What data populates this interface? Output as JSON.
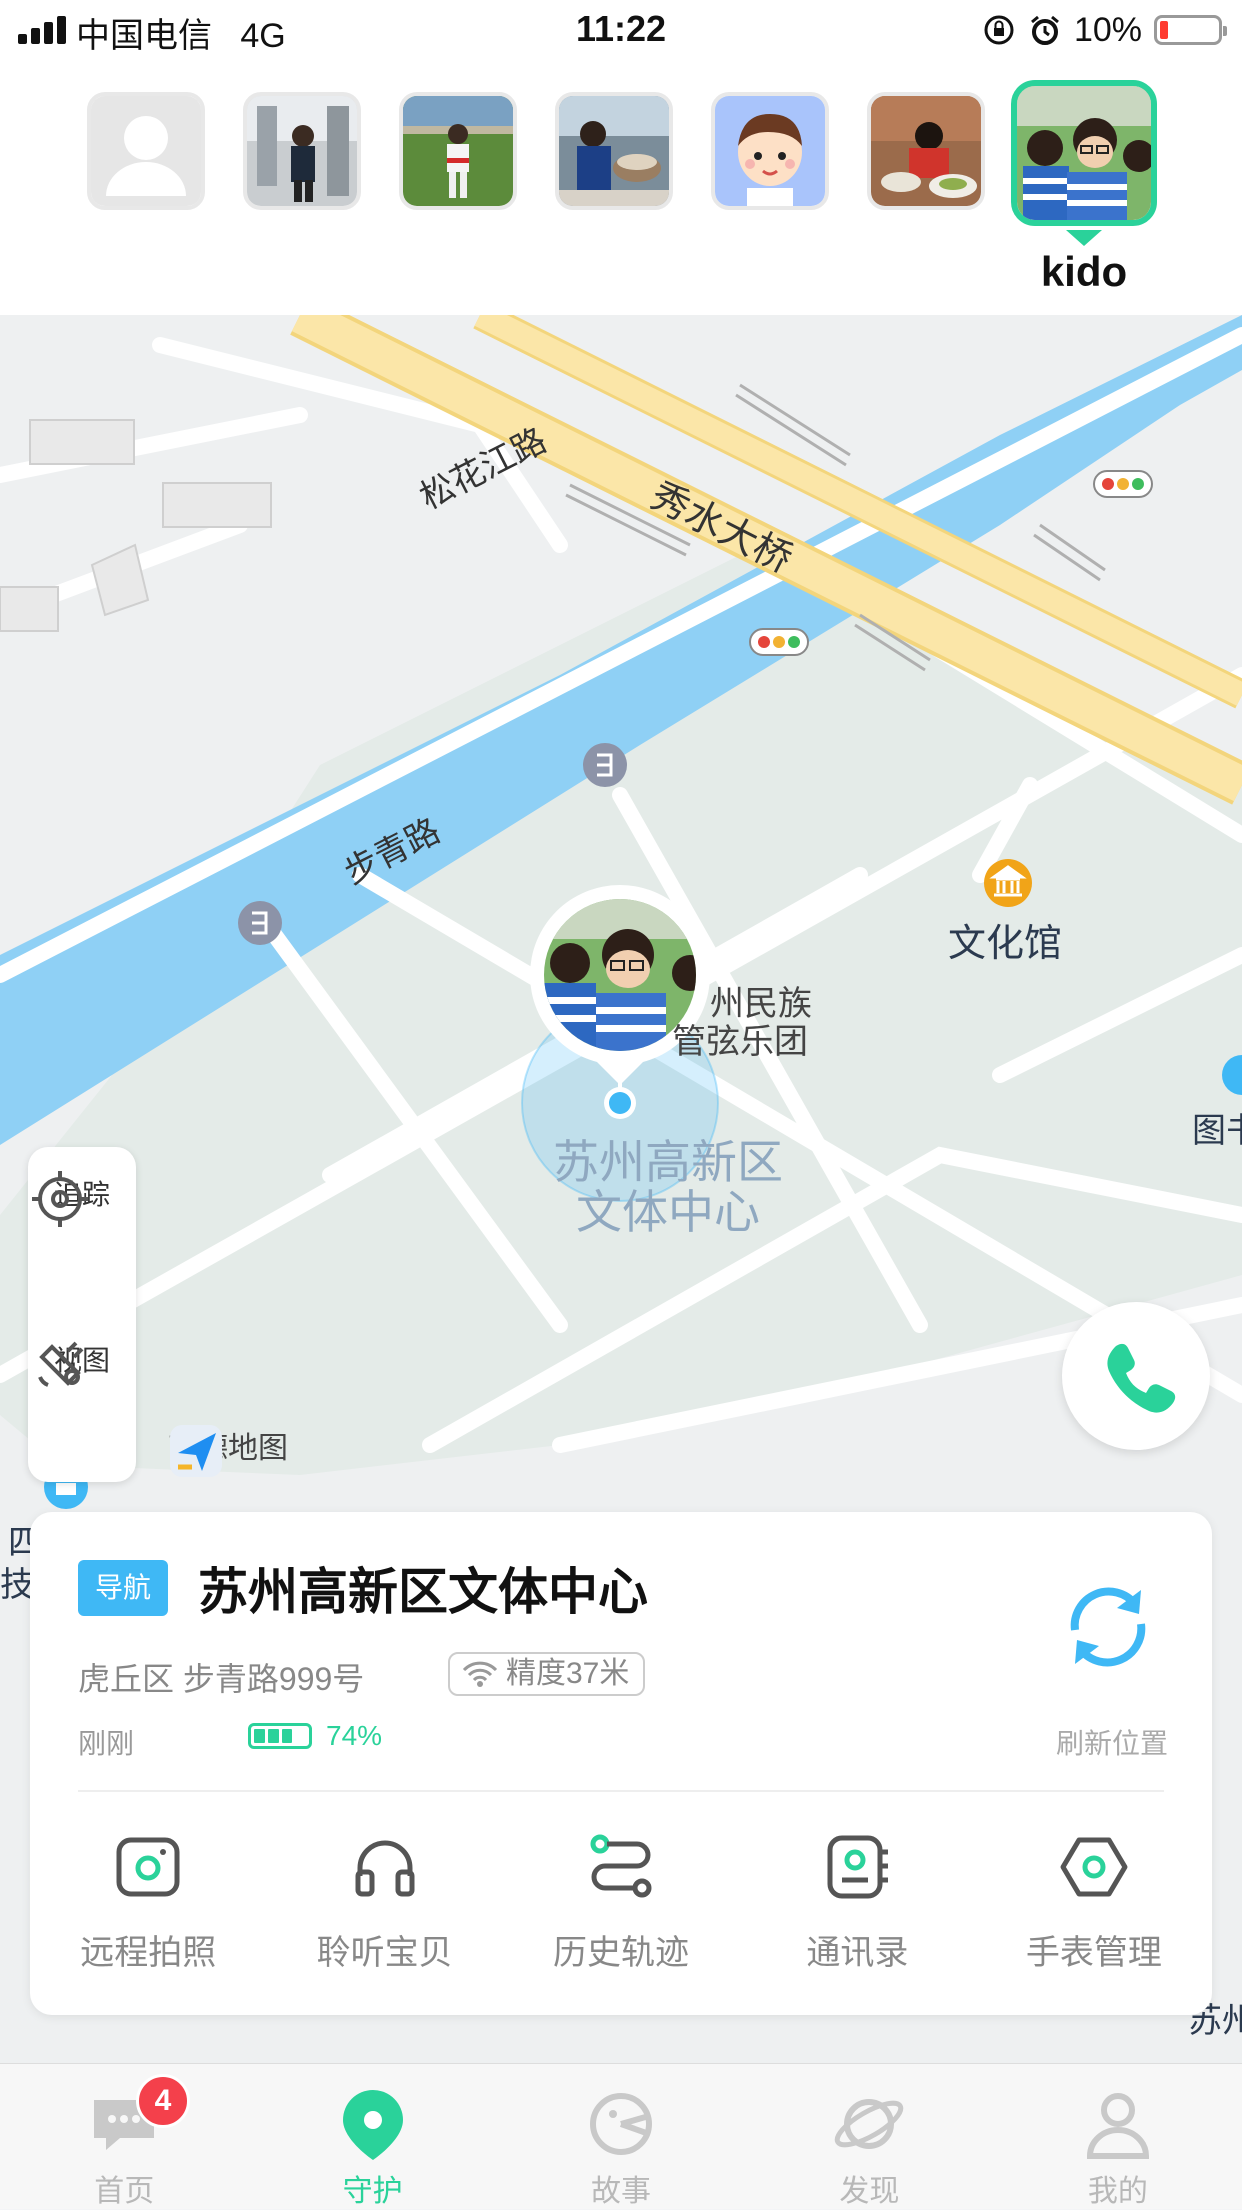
{
  "status_bar": {
    "carrier": "中国电信",
    "network": "4G",
    "time": "11:22",
    "battery_percent": "10%"
  },
  "avatars": {
    "items": [
      {
        "name": "default-avatar",
        "kind": "placeholder"
      },
      {
        "name": "child-photo-1",
        "kind": "photo"
      },
      {
        "name": "child-photo-2",
        "kind": "photo"
      },
      {
        "name": "child-photo-3",
        "kind": "photo"
      },
      {
        "name": "cartoon-avatar",
        "kind": "cartoon"
      },
      {
        "name": "child-photo-4",
        "kind": "photo"
      },
      {
        "name": "kido",
        "kind": "photo",
        "selected": true
      }
    ],
    "selected_name": "kido"
  },
  "map": {
    "road_labels": [
      "松花江路",
      "秀水大桥",
      "步青路"
    ],
    "poi_culture": "文化馆",
    "poi_troupe_line1": "州民族",
    "poi_troupe_line2": "管弦乐团",
    "poi_center_line1": "苏州高新区",
    "poi_center_line2": "文体中心",
    "edge_label_right": "图书",
    "edge_label_left1": "四",
    "edge_label_left2": "技",
    "edge_label_bottom": "苏州",
    "provider": "高德地图",
    "colors": {
      "water": "#8fd0f5",
      "highway": "#fbe6a8",
      "accent": "#2ad29a"
    }
  },
  "tools": {
    "track_label": "追踪",
    "view_label": "视图"
  },
  "card": {
    "nav_tag": "导航",
    "place_name": "苏州高新区文体中心",
    "address": "虎丘区 步青路999号",
    "accuracy": "精度37米",
    "updated": "刚刚",
    "watch_battery": "74%",
    "watch_battery_level": 0.74,
    "refresh_label": "刷新位置",
    "actions": [
      {
        "label": "远程拍照",
        "icon": "camera-icon"
      },
      {
        "label": "聆听宝贝",
        "icon": "headphones-icon"
      },
      {
        "label": "历史轨迹",
        "icon": "route-icon"
      },
      {
        "label": "通讯录",
        "icon": "contacts-icon"
      },
      {
        "label": "手表管理",
        "icon": "watch-settings-icon"
      }
    ]
  },
  "tabbar": {
    "tabs": [
      {
        "label": "首页",
        "icon": "chat-icon",
        "badge": "4"
      },
      {
        "label": "守护",
        "icon": "location-pin-icon",
        "active": true
      },
      {
        "label": "故事",
        "icon": "story-icon"
      },
      {
        "label": "发现",
        "icon": "planet-icon"
      },
      {
        "label": "我的",
        "icon": "profile-icon"
      }
    ]
  }
}
